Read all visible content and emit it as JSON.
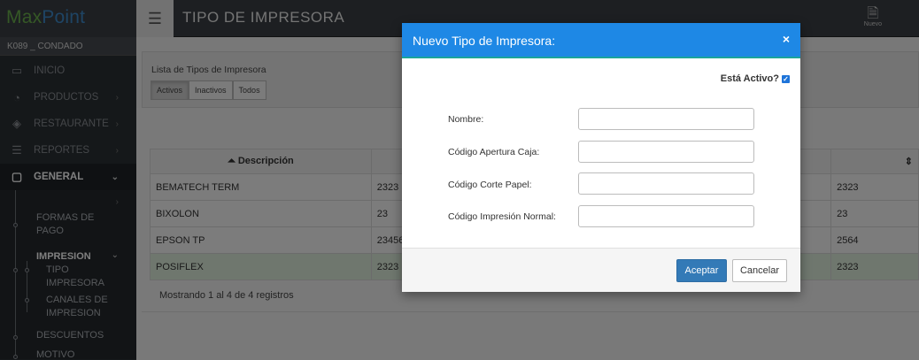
{
  "app": {
    "logo_part1": "Max",
    "logo_part2": "Point",
    "store": "K089 _ CONDADO"
  },
  "sidebar": {
    "items": [
      {
        "label": "INICIO",
        "icon": "laptop-icon"
      },
      {
        "label": "PRODUCTOS",
        "icon": "pie-chart-icon"
      },
      {
        "label": "RESTAURANTE",
        "icon": "layers-icon"
      },
      {
        "label": "REPORTES",
        "icon": "table-icon"
      },
      {
        "label": "GENERAL",
        "icon": "window-icon"
      }
    ],
    "sub": {
      "formas_pago": "FORMAS DE PAGO",
      "impresion": "IMPRESION",
      "tipo_impresora": "TIPO IMPRESORA",
      "canales": "CANALES DE IMPRESION",
      "descuentos": "DESCUENTOS",
      "motivo": "MOTIVO"
    }
  },
  "header": {
    "title": "TIPO DE IMPRESORA",
    "nuevo_label": "Nuevo"
  },
  "panel": {
    "title": "Lista de Tipos de Impresora",
    "filters": [
      "Activos",
      "Inactivos",
      "Todos"
    ]
  },
  "table": {
    "header": "Descripción",
    "rows": [
      {
        "desc": "BEMATECH TERM",
        "c2": "2323",
        "c3": "2323"
      },
      {
        "desc": "BIXOLON",
        "c2": "23",
        "c3": "23"
      },
      {
        "desc": "EPSON TP",
        "c2": "23456",
        "c3": "2564"
      },
      {
        "desc": "POSIFLEX",
        "c2": "2323",
        "c3": "2323"
      }
    ],
    "info": "Mostrando 1 al 4 de 4 registros"
  },
  "modal": {
    "title": "Nuevo Tipo de Impresora:",
    "close": "×",
    "activo_label": "Está Activo?",
    "fields": [
      "Nombre:",
      "Código Apertura Caja:",
      "Código Corte Papel:",
      "Código Impresión Normal:"
    ],
    "accept": "Aceptar",
    "cancel": "Cancelar"
  },
  "colors": {
    "modal_header": "#1e88e5",
    "accept_button": "#337ab7",
    "sidebar_bg": "#2b3035",
    "highlight_row": "#dfeedd"
  }
}
